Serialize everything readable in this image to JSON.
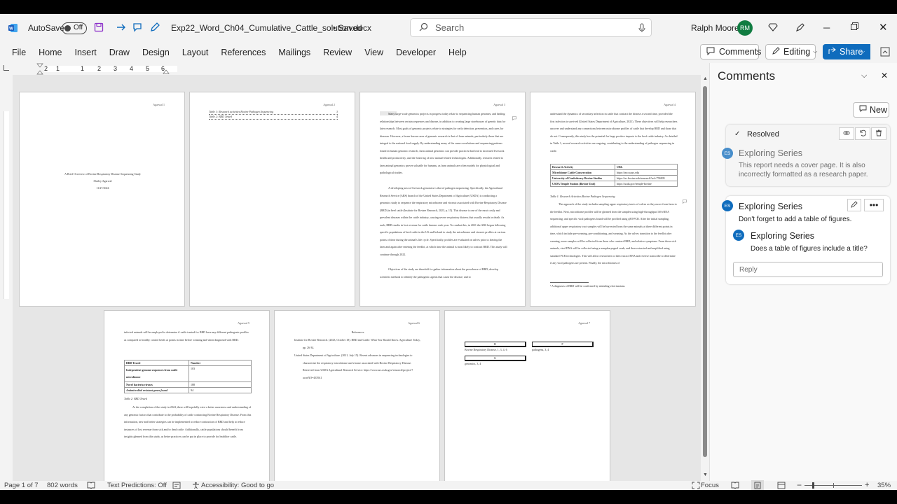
{
  "titlebar": {
    "autosave_label": "AutoSave",
    "autosave_state": "Off",
    "doc_title": "Exp22_Word_Ch04_Cumulative_Cattle_solution.docx",
    "saved_status": "• Saved",
    "search_placeholder": "Search",
    "user_name": "Ralph Moore",
    "user_initials": "RM"
  },
  "menu": [
    "File",
    "Home",
    "Insert",
    "Draw",
    "Design",
    "Layout",
    "References",
    "Mailings",
    "Review",
    "View",
    "Developer",
    "Help"
  ],
  "ribbon_right": {
    "comments": "Comments",
    "editing": "Editing",
    "share": "Share"
  },
  "ruler_numbers": [
    "2",
    "1",
    "1",
    "2",
    "3",
    "4",
    "5",
    "6"
  ],
  "pages": {
    "p1": {
      "num": "Agarwal 1",
      "title": "A Brief Overview of Bovine Respiratory Disease Sequencing Study",
      "author": "Shirley Agarwal",
      "date": "11/27/2024"
    },
    "p2": {
      "num": "Agarwal 2",
      "toc1": "Table 1: Research activities Bovine Pathogen Sequencing",
      "toc1p": "3",
      "toc2": "Table 2: BRD Tested",
      "toc2p": "4"
    },
    "p3": {
      "num": "Agarwal 3",
      "para1": "Many large-scale genomics projects in progress today relate to sequencing human genomes, and finding relationships between certain sequences and disease, in addition to creating large storehouses of genetic data for later research. Most goals of genomic projects relate to strategies for early detection, prevention, and cures for diseases. However, a lesser known area of genomic research is that of farm animals, particularly those that are integral to the national food supply. By understanding many of the same correlations and sequencing patterns found in human genomic research, farm animal genomics can provide practices that lead to increased livestock health and productivity, and the fostering of new animal-related technologies. Additionally, research related to farm animal genomics proves valuable for humans, as farm animals are often models for physiological and pathological studies.",
      "para2": "A developing area of livestock genomics is that of pathogen sequencing. Specifically, the Agricultural Research Service (ARS) branch of the United States Department of Agriculture (USDA) is conducting a genomics study to sequence the respiratory microbiome and viromic associated with Bovine Respiratory Disease (BRD) in beef cattle (Institute for Bovine Research, 2023, p. 15). This disease is one of the most costly and prevalent diseases within the cattle industry, causing severe respiratory distress that usually results in death. As such, BRD results in lost revenue for cattle farmers each year. To combat this, in 2021 the ARS began following specific populations of beef cattle in the US and Ireland to study the microbiome and viromic profiles at various points of time during the animal's life cycle. Specifically, profiles are evaluated on calves prior to leaving the farm and again after entering the feedlot, at which time the animal is most likely to contract BRD. This study will continue through 2022.",
      "para3": "Objectives of the study are threefold: to gather information about the prevalence of BRD; develop scientific methods to identify the pathogenic agents that cause the disease; and to"
    },
    "p4": {
      "num": "Agarwal 4",
      "para1": "understand the dynamics of secondary infection in cattle that contract the disease a second time, provided the first infection is survived (United States Department of Agriculture, 2021). These objectives will help researchers uncover and understand any connections between microbiome profiles of cattle that develop BRD and those that do not. Consequently, this study has the potential for large positive impacts to the beef cattle industry. As detailed in Table 1, several research activities are ongoing, contributing to the understanding of pathogen sequencing in cattle.",
      "table_head": [
        "Research Activity",
        "URL"
      ],
      "table_rows": [
        [
          "Microbiome Cattle Conservation",
          "https://mcca.ars.edu"
        ],
        [
          "University of Confederacy Bovine Studies",
          "https://uc.bovine.edu/research?ref=758499"
        ],
        [
          "USDA Temple Station (Bovine Unit)",
          "https://usda.gov/temple-bovine"
        ]
      ],
      "caption": "Table 1: Research Activities Bovine Pathogen Sequencing",
      "para2": "The approach of the study includes sampling upper respiratory tracts of calves as they move from farm to the feedlot. Next, microbiome profiles will be gleaned from the samples using high-throughput 16S rRNA sequencing, and specific viral pathogens found will be profiled using qRT-PCR. After the initial sampling, additional upper respiratory tract samples will be harvested from the same animals at three different points in time, which include pre-weaning, pre-conditioning, and weaning. As the calves transition to the feedlot after weaning, more samples will be collected from those who contract BRD, and relative symptoms. From these sick animals, viral DNA will be collected using a nasopharyngeal swab, and then extracted and amplified using standard PCR technologies. This will allow researchers to then extract RNA and reverse transcribe to determine if any viral pathogens are present. Finally, the microbiomes of",
      "footnote": "¹ A diagnosis of BRD will be confirmed by attending veterinarians."
    },
    "p5": {
      "num": "Agarwal 5",
      "para1": "infected animals will be employed to determine if cattle treated for BRD have any different pathogenic profiles as compared to healthy control herds at points in time before weaning and when diagnosed with BRD.",
      "table_head": [
        "BRD Tested",
        "Number"
      ],
      "table_rows": [
        [
          "Independent genome sequences from cattle microbiome",
          "103"
        ],
        [
          "Novel bacteria viruses",
          "188"
        ],
        [
          "Antimicrobial resistant genes found",
          "94"
        ]
      ],
      "caption": "Table 2: BRD Tested",
      "para2": "At the completion of the study in 2024, there will hopefully exist a better awareness and understanding of any genomic factors that contribute to the probability of cattle contracting Bovine Respiratory Disease. From this information, new and better strategies can be implemented to reduce contraction of BRD and help to reduce instances of lost revenue from sick and/or dead cattle. Additionally, cattle populations should benefit from insights gleaned from this study, as better practices can be put in place to provide for healthier cattle."
    },
    "p6": {
      "num": "Agarwal 6",
      "heading": "References",
      "ref1": "Institute for Bovine Research. (2023, October 18). BRD and Cattle: What You Should Know. Agriculture Today, pp. 26-34.",
      "ref2": "United States Department of Agriculture. (2021, July 15). Recent advances in sequencing technologies to characterize the respiratory microbiome and virome associated with Bovine Respiratory Disease. Retrieved from USDA Agricultural Research Service: https://www.ars.usda.gov/research/project/?accnNO=435941"
    },
    "p7": {
      "num": "Agarwal 7",
      "idx1": "B",
      "idx2": "P",
      "idx3": "G",
      "entry1": "Bovine Respiratory Disease, 1, 3, 4, 6",
      "entry2": "pathogens, 3, 4",
      "entry3": "genomics, 3, 4"
    }
  },
  "comments": {
    "header": "Comments",
    "new_label": "New",
    "resolved_label": "Resolved",
    "c1_author": "Exploring Series",
    "c1_text": "This report needs a cover page. It is also incorrectly formatted as a research paper.",
    "c2_author": "Exploring Series",
    "c2_text": "Don't forget to add a table of figures.",
    "c3_author": "Exploring Series",
    "c3_text": "Does a table of figures include a title?",
    "reply_placeholder": "Reply",
    "initials": "ES"
  },
  "status": {
    "page": "Page 1 of 7",
    "words": "802 words",
    "predictions": "Text Predictions: Off",
    "accessibility": "Accessibility: Good to go",
    "focus": "Focus",
    "zoom": "35%"
  },
  "colors": {
    "accent": "#0f6cbd",
    "green": "#107c41",
    "title_bg": "#f3f3f3"
  }
}
